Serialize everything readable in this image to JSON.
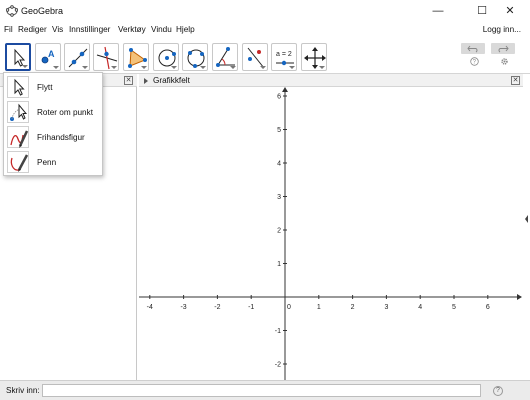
{
  "window": {
    "title": "GeoGebra",
    "controls": {
      "minimize": "—",
      "maximize": "☐",
      "close": "✕"
    }
  },
  "menu": {
    "items": [
      "Fil",
      "Rediger",
      "Vis",
      "Innstillinger",
      "Verktøy",
      "Vindu",
      "Hjelp"
    ],
    "login": "Logg inn..."
  },
  "toolbar": {
    "tools": [
      {
        "icon": "move-arrow-icon",
        "active": true
      },
      {
        "icon": "point-icon"
      },
      {
        "icon": "line-icon"
      },
      {
        "icon": "perpendicular-line-icon"
      },
      {
        "icon": "polygon-icon"
      },
      {
        "icon": "circle-center-icon"
      },
      {
        "icon": "circle-three-points-icon"
      },
      {
        "icon": "angle-icon"
      },
      {
        "icon": "reflect-icon"
      },
      {
        "icon": "slider-icon",
        "text": "a = 2"
      },
      {
        "icon": "move-view-icon"
      }
    ],
    "undo_icon": "undo-icon",
    "redo_icon": "redo-icon",
    "help_icon": "help-icon",
    "settings_icon": "gear-icon"
  },
  "dropdown": {
    "items": [
      {
        "label": "Flytt",
        "icon": "move-arrow-icon"
      },
      {
        "label": "Roter om punkt",
        "icon": "rotate-around-point-icon"
      },
      {
        "label": "Frihandsfigur",
        "icon": "freehand-shape-icon"
      },
      {
        "label": "Penn",
        "icon": "pen-icon"
      }
    ]
  },
  "graphics": {
    "title": "Grafikkfelt",
    "x_ticks": [
      "-4",
      "-3",
      "-2",
      "-1",
      "0",
      "1",
      "2",
      "3",
      "4",
      "5",
      "6"
    ],
    "y_ticks": [
      "6",
      "5",
      "4",
      "3",
      "2",
      "1",
      "-1",
      "-2"
    ],
    "x_range": [
      -4.4,
      6.9
    ],
    "y_range": [
      -2.7,
      6.3
    ]
  },
  "input_bar": {
    "label": "Skriv inn:",
    "value": "",
    "placeholder": "",
    "help": "?"
  },
  "colors": {
    "accent": "#1c4ba0",
    "point_blue": "#1565c0",
    "tool_red": "#c62828",
    "tool_orange": "#e0a000"
  }
}
